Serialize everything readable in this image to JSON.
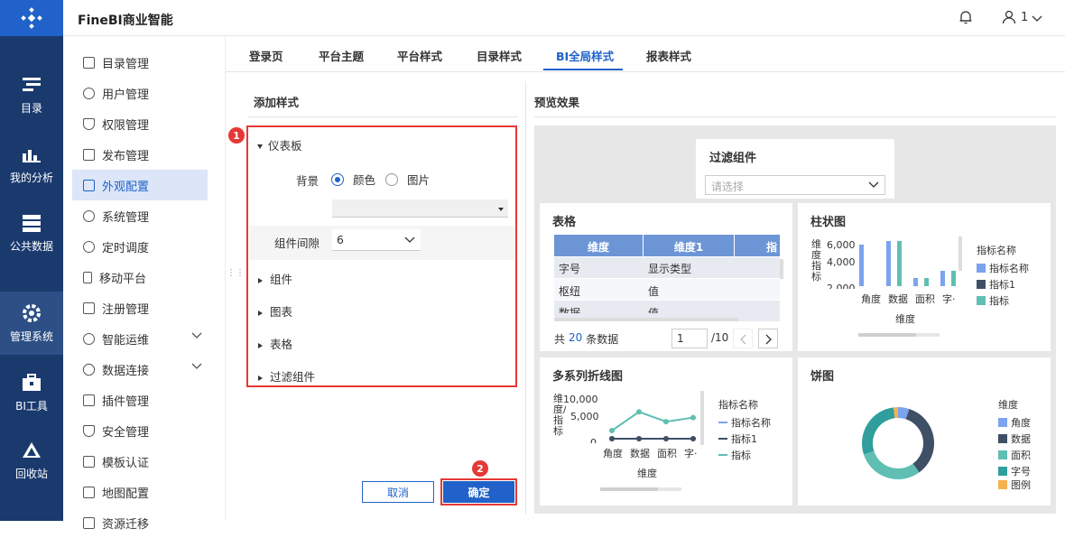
{
  "app": {
    "title": "FineBI商业智能",
    "user": "1"
  },
  "rail": [
    {
      "label": "目录",
      "icon": "catalog-icon"
    },
    {
      "label": "我的分析",
      "icon": "analysis-icon"
    },
    {
      "label": "公共数据",
      "icon": "database-icon"
    },
    {
      "label": "管理系统",
      "icon": "gear-icon"
    },
    {
      "label": "BI工具",
      "icon": "toolbox-icon"
    },
    {
      "label": "回收站",
      "icon": "recycle-icon"
    }
  ],
  "menu": [
    {
      "label": "目录管理"
    },
    {
      "label": "用户管理"
    },
    {
      "label": "权限管理"
    },
    {
      "label": "发布管理"
    },
    {
      "label": "外观配置"
    },
    {
      "label": "系统管理"
    },
    {
      "label": "定时调度"
    },
    {
      "label": "移动平台"
    },
    {
      "label": "注册管理"
    },
    {
      "label": "智能运维"
    },
    {
      "label": "数据连接"
    },
    {
      "label": "插件管理"
    },
    {
      "label": "安全管理"
    },
    {
      "label": "模板认证"
    },
    {
      "label": "地图配置"
    },
    {
      "label": "资源迁移"
    }
  ],
  "tabs": [
    "登录页",
    "平台主题",
    "平台样式",
    "目录样式",
    "BI全局样式",
    "报表样式"
  ],
  "left": {
    "heading": "添加样式",
    "badge1": "1",
    "badge2": "2",
    "dashboard": "仪表板",
    "bg_label": "背景",
    "opt_color": "颜色",
    "opt_image": "图片",
    "gap_label": "组件间隙",
    "gap_value": "6",
    "sections": [
      "组件",
      "图表",
      "表格",
      "过滤组件"
    ],
    "cancel": "取消",
    "confirm": "确定"
  },
  "preview": {
    "heading": "预览效果",
    "filter": {
      "title": "过滤组件",
      "placeholder": "请选择"
    },
    "table": {
      "title": "表格",
      "headers": [
        "维度",
        "维度1",
        "指"
      ],
      "rows": [
        [
          "字号",
          "显示类型"
        ],
        [
          "枢纽",
          "值"
        ],
        [
          "数据",
          "值"
        ]
      ],
      "footer_pre": "共",
      "count": "20",
      "footer_post": "条数据",
      "page": "1",
      "total": "/10"
    },
    "bar": {
      "title": "柱状图",
      "ylabel": "维度\n指\n标",
      "yticks": [
        "6,000",
        "4,000",
        "2,000"
      ],
      "xlabels": [
        "角度",
        "数据",
        "面积",
        "字·"
      ],
      "xtitle": "维度",
      "legend_title": "指标名称",
      "legend": [
        "指标名称",
        "指标1",
        "指标"
      ]
    },
    "line": {
      "title": "多系列折线图",
      "ylabel": "维度/指标",
      "yticks": [
        "10,000",
        "5,000",
        "0"
      ],
      "xlabels": [
        "角度",
        "数据",
        "面积",
        "字·"
      ],
      "xtitle": "维度",
      "legend_title": "指标名称",
      "legend": [
        "指标名称",
        "指标1",
        "指标"
      ]
    },
    "pie": {
      "title": "饼图",
      "legend_title": "维度",
      "legend": [
        "角度",
        "数据",
        "面积",
        "字号",
        "图例"
      ]
    }
  },
  "chart_data": [
    {
      "type": "bar",
      "title": "柱状图",
      "categories": [
        "角度",
        "数据",
        "面积",
        "字·"
      ],
      "series": [
        {
          "name": "指标名称",
          "values": [
            5200,
            5600,
            1500,
            2300
          ]
        },
        {
          "name": "指标1",
          "values": [
            0,
            0,
            0,
            0
          ]
        },
        {
          "name": "指标",
          "values": [
            0,
            5600,
            1500,
            2300
          ]
        }
      ],
      "ylim": [
        2000,
        6000
      ],
      "legend_title": "指标名称",
      "legend": "right",
      "xlabel": "维度"
    },
    {
      "type": "line",
      "title": "多系列折线图",
      "categories": [
        "角度",
        "数据",
        "面积",
        "字·"
      ],
      "series": [
        {
          "name": "指标名称",
          "values": [
            0,
            0,
            0,
            0
          ]
        },
        {
          "name": "指标1",
          "values": [
            0,
            0,
            0,
            0
          ]
        },
        {
          "name": "指标",
          "values": [
            2000,
            6600,
            4200,
            5200
          ]
        }
      ],
      "ylim": [
        0,
        10000
      ],
      "legend_title": "指标名称",
      "legend": "right",
      "xlabel": "维度"
    },
    {
      "type": "pie",
      "title": "饼图",
      "categories": [
        "角度",
        "数据",
        "面积",
        "字号",
        "图例"
      ],
      "values": [
        5,
        35,
        30,
        28,
        2
      ],
      "legend_title": "维度",
      "legend": "right"
    }
  ],
  "colors": {
    "accent": "#2062c9",
    "rail": "#1a3a6e",
    "red": "#e53935",
    "blue": "#7ba3ee",
    "dark": "#3f4f66",
    "teal": "#5fbfb3",
    "teal2": "#2f9e9c",
    "orange": "#f5b24f"
  }
}
